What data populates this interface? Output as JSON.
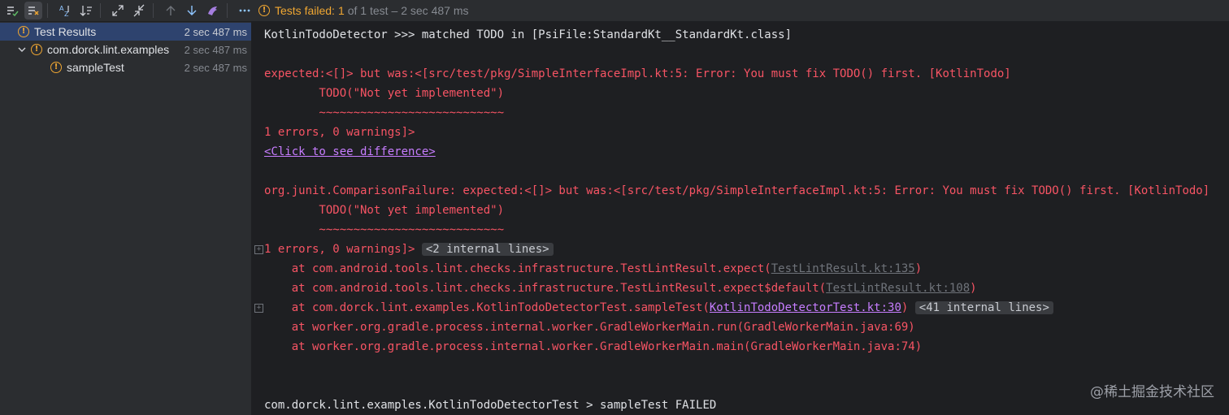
{
  "toolbar": {
    "buttons": [
      "show-passed-icon",
      "show-ignored-icon",
      "sort-alphabetically-icon",
      "sort-by-duration-icon",
      "expand-all-icon",
      "collapse-all-icon",
      "previous-failed-icon",
      "next-failed-icon",
      "import-tests-icon",
      "more-icon"
    ],
    "status": {
      "prefix": "Tests failed:",
      "count": "1",
      "of_text": "of 1 test",
      "duration": "– 2 sec 487 ms"
    }
  },
  "tree": {
    "items": [
      {
        "label": "Test Results",
        "time": "2 sec 487 ms"
      },
      {
        "label": "com.dorck.lint.examples",
        "time": "2 sec 487 ms"
      },
      {
        "label": "sampleTest",
        "time": "2 sec 487 ms"
      }
    ]
  },
  "console": {
    "l1": "KotlinTodoDetector >>> matched TODO in [PsiFile:StandardKt__StandardKt.class]",
    "l2": "expected:<[]> but was:<[src/test/pkg/SimpleInterfaceImpl.kt:5: Error: You must fix TODO() first. [KotlinTodo]",
    "l3": "        TODO(\"Not yet implemented\")",
    "l4": "        ~~~~~~~~~~~~~~~~~~~~~~~~~~~",
    "l5": "1 errors, 0 warnings]>",
    "l6": "<Click to see difference>",
    "l7": "org.junit.ComparisonFailure: expected:<[]> but was:<[src/test/pkg/SimpleInterfaceImpl.kt:5: Error: You must fix TODO() first. [KotlinTodo]",
    "l8": "        TODO(\"Not yet implemented\")",
    "l9": "        ~~~~~~~~~~~~~~~~~~~~~~~~~~~",
    "l10": "1 errors, 0 warnings]>",
    "l10_fold": "<2 internal lines>",
    "l11_pre": "    at com.android.tools.lint.checks.infrastructure.TestLintResult.expect(",
    "l11_link": "TestLintResult.kt:135",
    "l11_post": ")",
    "l12_pre": "    at com.android.tools.lint.checks.infrastructure.TestLintResult.expect$default(",
    "l12_link": "TestLintResult.kt:108",
    "l12_post": ")",
    "l13_pre": "    at com.dorck.lint.examples.KotlinTodoDetectorTest.sampleTest(",
    "l13_link": "KotlinTodoDetectorTest.kt:30",
    "l13_post": ")",
    "l13_fold": "<41 internal lines>",
    "l14": "    at worker.org.gradle.process.internal.worker.GradleWorkerMain.run(GradleWorkerMain.java:69)",
    "l15": "    at worker.org.gradle.process.internal.worker.GradleWorkerMain.main(GradleWorkerMain.java:74)",
    "l16": "com.dorck.lint.examples.KotlinTodoDetectorTest > sampleTest FAILED",
    "expander": "+"
  },
  "watermark": "@稀土掘金技术社区",
  "colors": {
    "error": "#f75464",
    "warning": "#f0a732",
    "selection": "#2e436e",
    "link": "#c77dff"
  }
}
